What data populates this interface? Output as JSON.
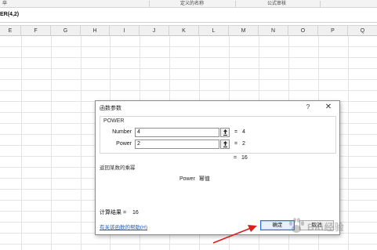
{
  "ribbon": {
    "left_fragment": "卒",
    "group_defined_names": "定义的名称",
    "group_formula_auditing": "公式审核"
  },
  "formula_bar": {
    "formula_text": "ER(4,2)"
  },
  "columns": [
    "E",
    "F",
    "G",
    "H",
    "I",
    "J",
    "K",
    "L",
    "M",
    "N",
    "O",
    "P",
    "Q"
  ],
  "dialog": {
    "title": "函数参数",
    "help_glyph": "?",
    "close_glyph": "✕",
    "function_name": "POWER",
    "args": [
      {
        "label": "Number",
        "value": "4",
        "eq": "=",
        "result": "4"
      },
      {
        "label": "Power",
        "value": "2",
        "eq": "=",
        "result": "2"
      }
    ],
    "total_eq": "=",
    "total_result": "16",
    "description": "返回某数的乘幂",
    "arg_desc_name": "Power",
    "arg_desc_text": "幂值",
    "calc_label": "计算结果 =",
    "calc_value": "16",
    "help_link": "有关该函数的帮助(H)",
    "ok_label": "确定",
    "cancel_label": "取消"
  },
  "watermark": {
    "text": "Bai经验"
  },
  "colors": {
    "annotation_arrow": "#d9201c",
    "ok_border": "#2d6fd2",
    "link": "#1a5fb4"
  },
  "icons": [
    "help-icon",
    "close-icon",
    "range-selector-icon",
    "annotation-arrow",
    "paw-watermark-icon"
  ]
}
